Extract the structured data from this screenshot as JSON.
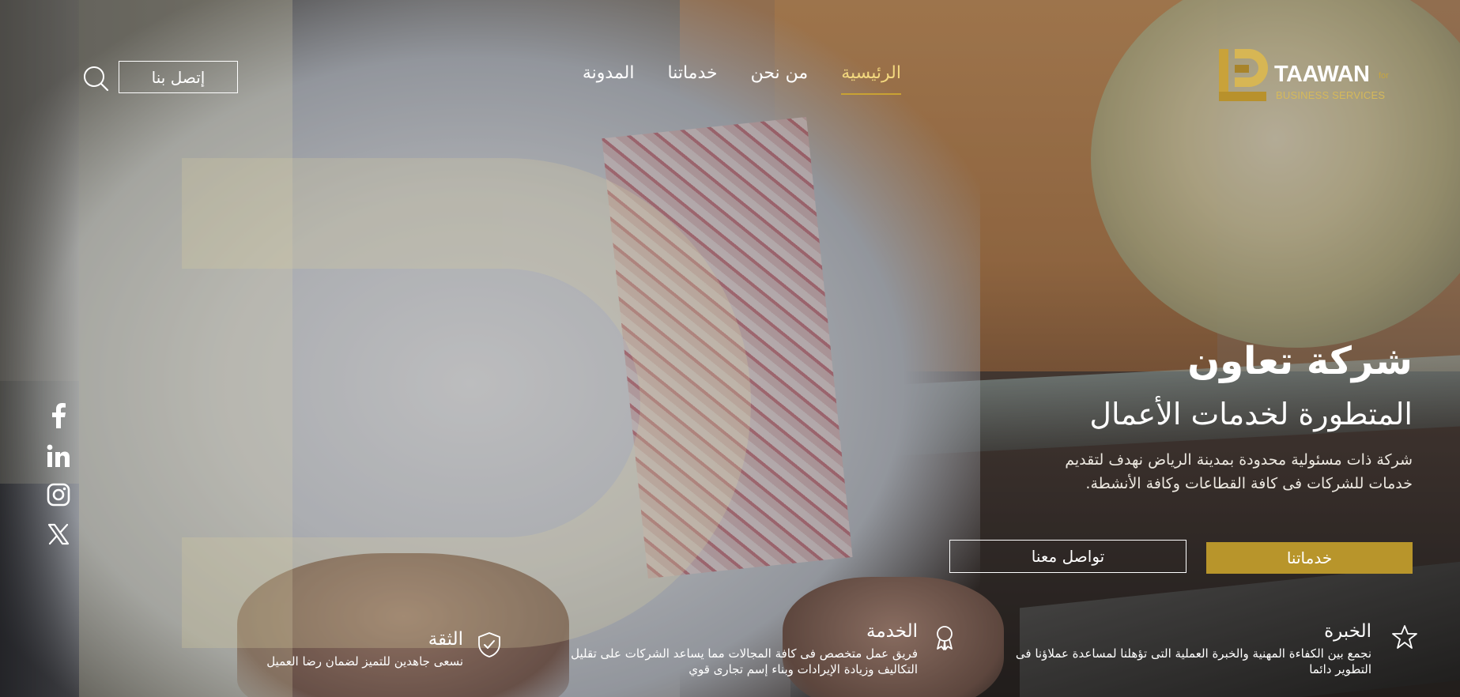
{
  "brand": {
    "name": "TAAWAN",
    "for": "for",
    "subtitle": "BUSINESS SERVICES",
    "accent_color": "#b8952b"
  },
  "nav": {
    "items": [
      {
        "label": "الرئيسية",
        "active": true
      },
      {
        "label": "من نحن"
      },
      {
        "label": "خدماتنا"
      },
      {
        "label": "المدونة"
      }
    ],
    "contact_label": "إتصل بنا",
    "search_icon": "search-icon"
  },
  "hero": {
    "title": "شركة تعاون",
    "subtitle": "المتطورة لخدمات الأعمال",
    "description": "شركة ذات مسئولية محدودة بمدينة الرياض نهدف لتقديم خدمات للشركات فى كافة القطاعات وكافة الأنشطة.",
    "primary_button": "خدماتنا",
    "secondary_button": "تواصل معنا"
  },
  "features": [
    {
      "icon": "star-icon",
      "title": "الخبرة",
      "description": "نجمع بين الكفاءة المهنية والخبرة العملية التى تؤهلنا لمساعدة عملاؤنا فى التطوير دائما"
    },
    {
      "icon": "award-icon",
      "title": "الخدمة",
      "description": "فريق عمل متخصص فى كافة المجالات مما يساعد الشركات على تقليل التكاليف وزيادة الإيرادات وبناء إسم تجارى قوي"
    },
    {
      "icon": "shield-check-icon",
      "title": "الثقة",
      "description": "نسعى جاهدين للتميز لضمان رضا العميل"
    }
  ],
  "social": [
    "facebook-icon",
    "linkedin-icon",
    "instagram-icon",
    "x-icon"
  ]
}
